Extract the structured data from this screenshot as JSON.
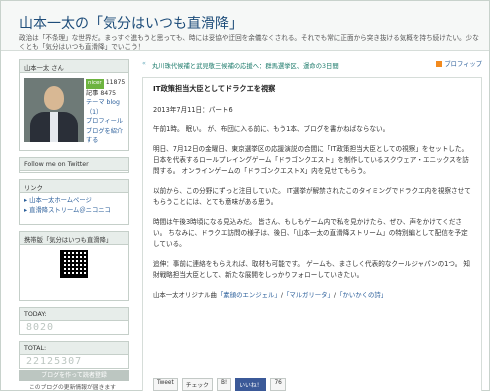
{
  "header": {
    "title": "山本一太の「気分はいつも直滑降」",
    "description": "政治は「不条理」な世界だ。まっすぐ進もうと思っても、時には妥協や迂回を余儀なくされる。それでも常に正面から突き抜ける気概を持ち続けたい。少なくとも「気分はいつも直滑降」でいこう！"
  },
  "sidebar": {
    "profile_heading": "山本一太 さん",
    "badge": "nicer",
    "nicer_count": "11875",
    "posts_label": "記事 8475",
    "theme_label": "テーマ blog（1）",
    "profile_link": "プロフィール",
    "blog_intro_link": "ブログを紹介する",
    "follow_heading": "Follow me on Twitter",
    "links_heading": "リンク",
    "links": [
      "山本一太ホームページ",
      "直滑降ストリーム＠ニコニコ"
    ],
    "mobile_heading": "携帯版「気分はいつも直滑降」",
    "today_heading": "TODAY:",
    "today_count": "8020",
    "total_heading": "TOTAL:",
    "total_count": "22125307",
    "blog_button": "ブログを作って読者登録",
    "update_note": "このブログの更新情報が届きます"
  },
  "ticker": {
    "text": "丸川珠代候補と武見敬三候補の応援へ：群馬選挙区、運命の3日間",
    "feed": "ブロフィップ"
  },
  "post": {
    "title": "IT政策担当大臣としてドラクエを視察",
    "date": "2013年7月11日：パート6",
    "paragraphs": [
      "午前1時。 眠い。 が、布団に入る前に、もう1本、ブログを書かねばならない。",
      "明日、7月12日の金曜日、東京選挙区の応援演説の合間に「IT政策担当大臣としての視察」をセットした。 日本を代表するロールプレイングゲーム「ドラゴンクエスト」を制作しているスクウェア・エニックスを訪問する。 オンラインゲームの「ドラゴンクエストX」内を見せてもらう。",
      "以前から、この分野にずっと注目していた。 IT選挙が解禁されたこのタイミングでドラクエ内を視察させてもらうことには、とても意味がある思う。",
      "時間は午後3時頃になる見込みだ。 皆さん、もしもゲーム内で私を見かけたら、ぜひ、声をかけてください。 ちなみに、ドラクエ訪問の様子は、後日、「山本一太の直滑降ストリーム」の特別編として配信を予定している。",
      "追伸：事前に連絡をもらえれば、取材も可能です。 ゲームも、まさしく代表的なクールジャパンの1つ。 知財戦略担当大臣として、新たな展開をしっかりフォローしていきたい。"
    ],
    "songs_prefix": "山本一太オリジナル曲",
    "songs": [
      "「素顔のエンジェル」",
      "「マルガリータ」",
      "「かいかくの詩」"
    ],
    "share": {
      "tweet": "Tweet",
      "check": "チェック",
      "bookmark": "B!",
      "like": "いいね！",
      "count": "76"
    }
  }
}
